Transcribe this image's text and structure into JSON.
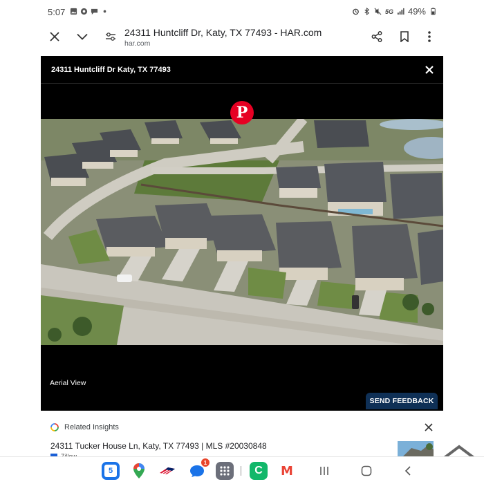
{
  "status_bar": {
    "time": "5:07",
    "network": "5G",
    "battery": "49%",
    "left_icons": [
      "photo-icon",
      "settings-icon",
      "message-icon",
      "dot-icon"
    ],
    "right_icons": [
      "alarm-icon",
      "bluetooth-icon",
      "mute-icon",
      "5g-icon",
      "signal-icon",
      "battery-icon"
    ]
  },
  "browser": {
    "page_title": "24311 Huntcliff Dr, Katy, TX 77493 - HAR.com",
    "domain": "har.com"
  },
  "modal": {
    "title": "24311 Huntcliff Dr Katy, TX 77493",
    "caption": "Aerial View",
    "feedback_label": "SEND FEEDBACK",
    "pin_label": "P"
  },
  "insights": {
    "label": "Related Insights",
    "result_title": "24311 Tucker House Ln, Katy, TX 77493 | MLS #20030848",
    "result_source": "Zillow"
  },
  "dock": {
    "calendar_day": "5",
    "messages_badge": "1",
    "phone_label": "C",
    "gmail_label": "M"
  },
  "colors": {
    "modal_bg": "#000000",
    "feedback_bg": "#0f3056",
    "pinterest": "#e60023"
  }
}
